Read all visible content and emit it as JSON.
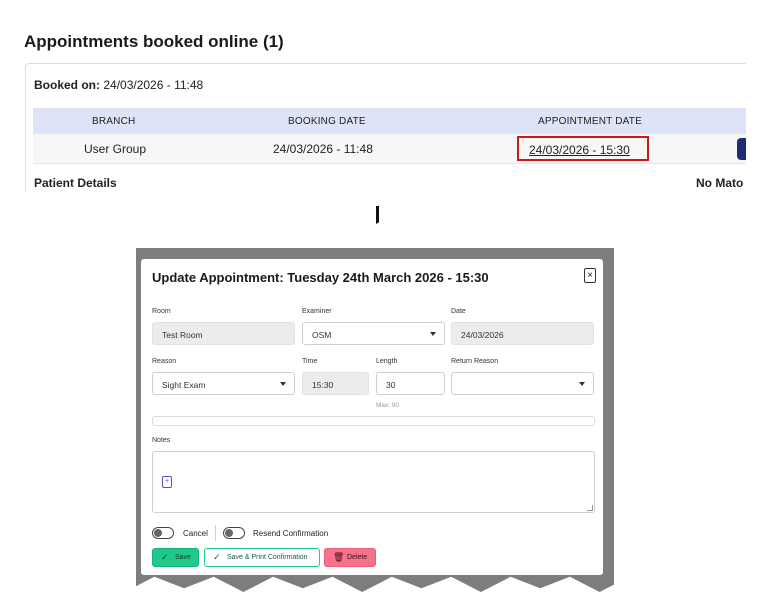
{
  "top": {
    "title": "Appointments booked online (1)",
    "booked_on_label": "Booked on:",
    "booked_on_value": "24/03/2026 - 11:48",
    "columns": [
      "BRANCH",
      "BOOKING DATE",
      "APPOINTMENT DATE"
    ],
    "row": {
      "branch": "User Group",
      "booking_date": "24/03/2026 - 11:48",
      "appointment_date": "24/03/2026 - 15:30"
    },
    "patient_details": "Patient Details",
    "no_match": "No Mato"
  },
  "modal": {
    "title": "Update Appointment: Tuesday 24th March 2026 - 15:30",
    "close_glyph": "×",
    "room": {
      "label": "Room",
      "value": "Test Room"
    },
    "examiner": {
      "label": "Examiner",
      "value": "OSM"
    },
    "date": {
      "label": "Date",
      "value": "24/03/2026"
    },
    "reason": {
      "label": "Reason",
      "value": "Sight Exam"
    },
    "time": {
      "label": "Time",
      "value": "15:30"
    },
    "length": {
      "label": "Length",
      "value": "30",
      "hint": "Max: 90"
    },
    "return_reason": {
      "label": "Return Reason",
      "value": ""
    },
    "notes_label": "Notes",
    "cancel_label": "Cancel",
    "resend_label": "Resend Confirmation",
    "save_label": "Save",
    "print_label": "Save & Print Confirmation",
    "delete_label": "Delete"
  },
  "colors": {
    "table_header_bg": "#dfe3f7",
    "highlight_border": "#d01818",
    "save_green": "#1fc98a",
    "delete_pink": "#f4728a",
    "navy_button": "#1f2a7a"
  },
  "icons": {
    "down_arrow": "arrow-down-icon",
    "close": "close-icon",
    "notes": "add-file-icon",
    "save": "check-icon",
    "print": "check-icon",
    "delete": "trash-icon"
  }
}
